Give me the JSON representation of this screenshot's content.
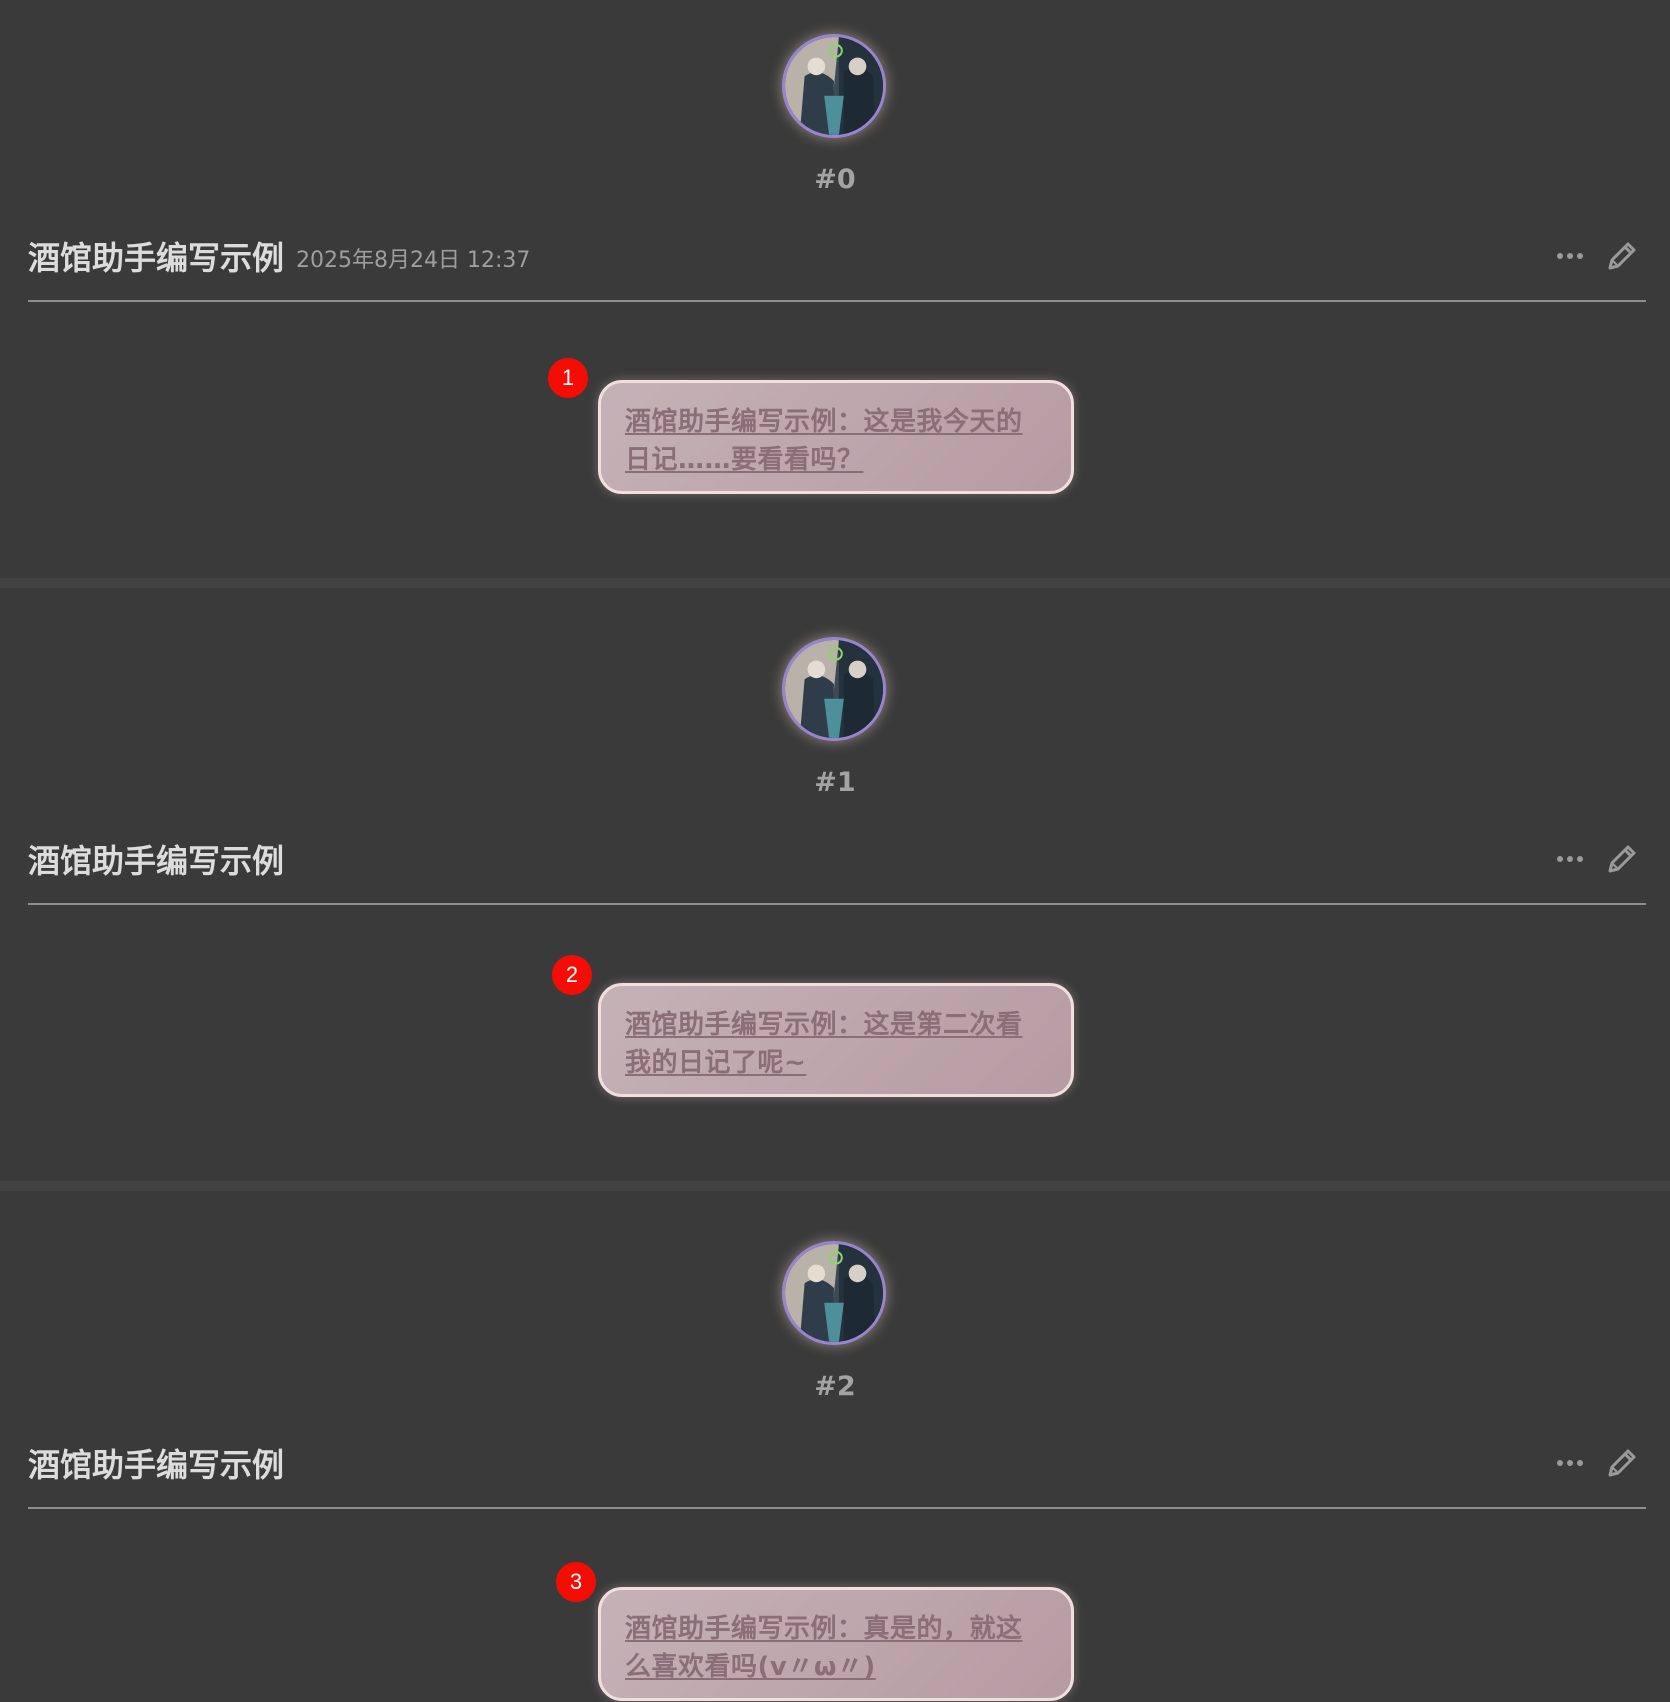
{
  "messages": [
    {
      "mes_id": "#0",
      "name": "酒馆助手编写示例",
      "timestamp": "2025年8月24日 12:37",
      "badge": "1",
      "bubble_text": "酒馆助手编写示例：这是我今天的日记……要看看吗？"
    },
    {
      "mes_id": "#1",
      "name": "酒馆助手编写示例",
      "timestamp": "",
      "badge": "2",
      "bubble_text": "酒馆助手编写示例：这是第二次看我的日记了呢~"
    },
    {
      "mes_id": "#2",
      "name": "酒馆助手编写示例",
      "timestamp": "",
      "badge": "3",
      "bubble_text": "酒馆助手编写示例：真是的，就这么喜欢看吗(v〃ω〃)"
    }
  ],
  "icons": {
    "more": "ellipsis-icon",
    "edit": "pencil-icon"
  },
  "colors": {
    "background": "#3a3a3a",
    "badge": "#f50d05",
    "bubble": "#b69ba3",
    "avatar_border": "#9b83d4"
  }
}
